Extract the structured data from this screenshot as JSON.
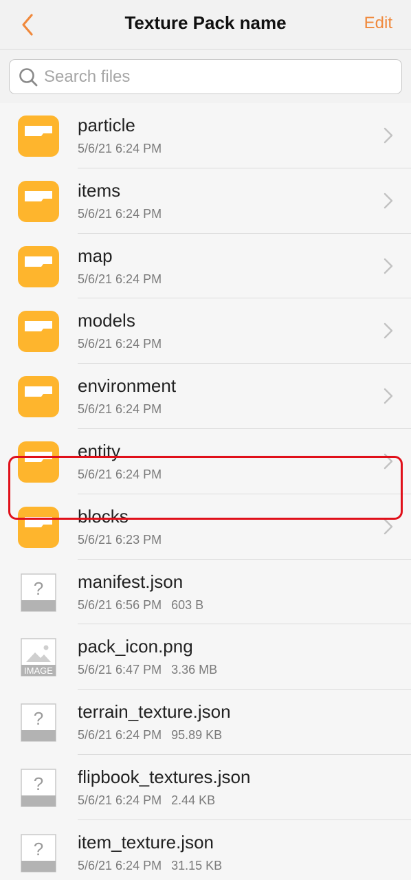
{
  "header": {
    "title": "Texture Pack name",
    "edit_label": "Edit"
  },
  "search": {
    "placeholder": "Search files"
  },
  "colors": {
    "accent": "#f0893c",
    "folder": "#feb52d",
    "highlight": "#e0101a"
  },
  "items": [
    {
      "name": "particle",
      "date": "5/6/21 6:24 PM",
      "size": "",
      "kind": "folder",
      "icon": "folder-icon"
    },
    {
      "name": "items",
      "date": "5/6/21 6:24 PM",
      "size": "",
      "kind": "folder",
      "icon": "folder-icon"
    },
    {
      "name": "map",
      "date": "5/6/21 6:24 PM",
      "size": "",
      "kind": "folder",
      "icon": "folder-icon"
    },
    {
      "name": "models",
      "date": "5/6/21 6:24 PM",
      "size": "",
      "kind": "folder",
      "icon": "folder-icon"
    },
    {
      "name": "environment",
      "date": "5/6/21 6:24 PM",
      "size": "",
      "kind": "folder",
      "icon": "folder-icon"
    },
    {
      "name": "entity",
      "date": "5/6/21 6:24 PM",
      "size": "",
      "kind": "folder",
      "icon": "folder-icon"
    },
    {
      "name": "blocks",
      "date": "5/6/21 6:23 PM",
      "size": "",
      "kind": "folder",
      "icon": "folder-icon"
    },
    {
      "name": "manifest.json",
      "date": "5/6/21 6:56 PM",
      "size": "603 B",
      "kind": "unknown",
      "icon": "unknown-file-icon",
      "highlighted": true
    },
    {
      "name": "pack_icon.png",
      "date": "5/6/21 6:47 PM",
      "size": "3.36 MB",
      "kind": "image",
      "icon": "image-file-icon",
      "icon_label": "IMAGE"
    },
    {
      "name": "terrain_texture.json",
      "date": "5/6/21 6:24 PM",
      "size": "95.89 KB",
      "kind": "unknown",
      "icon": "unknown-file-icon"
    },
    {
      "name": "flipbook_textures.json",
      "date": "5/6/21 6:24 PM",
      "size": "2.44 KB",
      "kind": "unknown",
      "icon": "unknown-file-icon"
    },
    {
      "name": "item_texture.json",
      "date": "5/6/21 6:24 PM",
      "size": "31.15 KB",
      "kind": "unknown",
      "icon": "unknown-file-icon"
    }
  ]
}
